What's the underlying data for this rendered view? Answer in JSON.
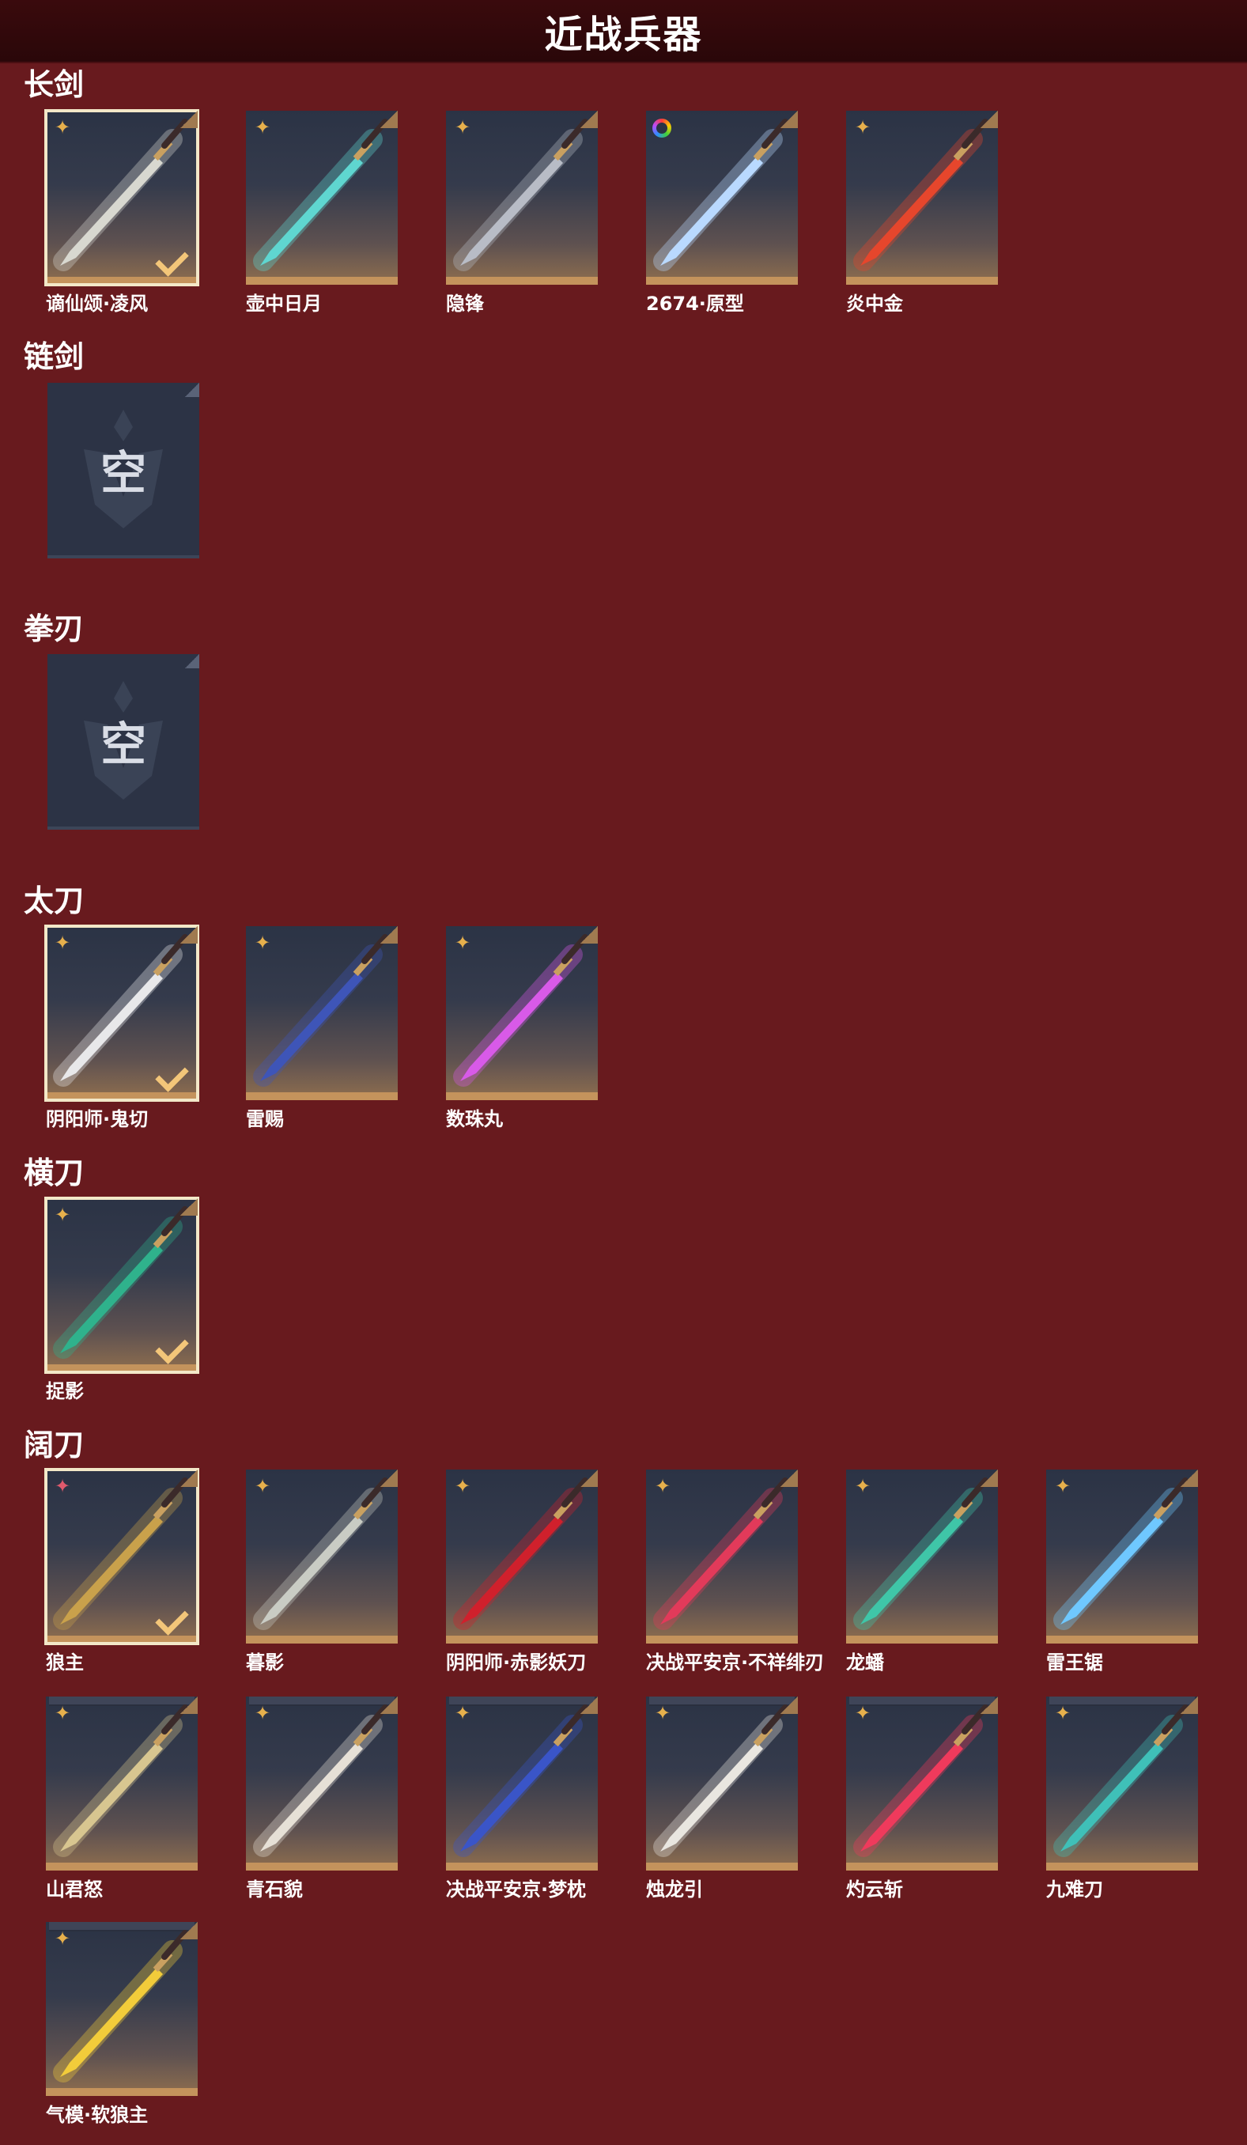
{
  "header": {
    "title": "近战兵器"
  },
  "sections": [
    {
      "title": "长剑",
      "items": [
        {
          "label": "谪仙颂·凌风",
          "badge": "star",
          "selected": true,
          "blade": "#d8d8d0"
        },
        {
          "label": "壶中日月",
          "badge": "star",
          "selected": false,
          "blade": "#5fd6d0"
        },
        {
          "label": "隐锋",
          "badge": "star",
          "selected": false,
          "blade": "#b8bcc6"
        },
        {
          "label": "2674·原型",
          "badge": "rainbow-ring",
          "selected": false,
          "blade": "#b9d9ff"
        },
        {
          "label": "炎中金",
          "badge": "star",
          "selected": false,
          "blade": "#e6462c"
        }
      ]
    },
    {
      "title": "链剑",
      "empty": "空"
    },
    {
      "title": "拳刃",
      "empty": "空"
    },
    {
      "title": "太刀",
      "items": [
        {
          "label": "阴阳师·鬼切",
          "badge": "star",
          "selected": true,
          "blade": "#e8e8ea"
        },
        {
          "label": "雷赐",
          "badge": "star",
          "selected": false,
          "blade": "#3e55b8"
        },
        {
          "label": "数珠丸",
          "badge": "star",
          "selected": false,
          "blade": "#d85ae8"
        }
      ]
    },
    {
      "title": "横刀",
      "items": [
        {
          "label": "捉影",
          "badge": "star",
          "selected": true,
          "blade": "#2fb28c"
        }
      ]
    },
    {
      "title": "阔刀",
      "items": [
        {
          "label": "狼主",
          "badge": "star-red",
          "selected": true,
          "blade": "#c9a14b"
        },
        {
          "label": "暮影",
          "badge": "star",
          "selected": false,
          "blade": "#c9ccc4"
        },
        {
          "label": "阴阳师·赤影妖刀",
          "badge": "star",
          "selected": false,
          "blade": "#d0202c"
        },
        {
          "label": "决战平安京·不祥绯刃",
          "badge": "star",
          "selected": false,
          "blade": "#e23a5a"
        },
        {
          "label": "龙蟠",
          "badge": "star",
          "selected": false,
          "blade": "#3fc6a8"
        },
        {
          "label": "雷王锯",
          "badge": "star",
          "selected": false,
          "blade": "#6fc8ff"
        },
        {
          "label": "山君怒",
          "badge": "star",
          "selected": false,
          "blade": "#d8c690",
          "stack": true
        },
        {
          "label": "青石貌",
          "badge": "star",
          "selected": false,
          "blade": "#e6e0d6",
          "stack": true
        },
        {
          "label": "决战平安京·梦枕",
          "badge": "star",
          "selected": false,
          "blade": "#3a55c8",
          "stack": true
        },
        {
          "label": "烛龙引",
          "badge": "star",
          "selected": false,
          "blade": "#e9e6e0",
          "stack": true
        },
        {
          "label": "灼云斩",
          "badge": "star",
          "selected": false,
          "blade": "#ef3a5c",
          "stack": true
        },
        {
          "label": "九难刀",
          "badge": "star",
          "selected": false,
          "blade": "#3fc0b8",
          "stack": true
        },
        {
          "label": "气模·软狼主",
          "badge": "star",
          "selected": false,
          "blade": "#f2cc3a",
          "stack": true
        }
      ]
    }
  ]
}
